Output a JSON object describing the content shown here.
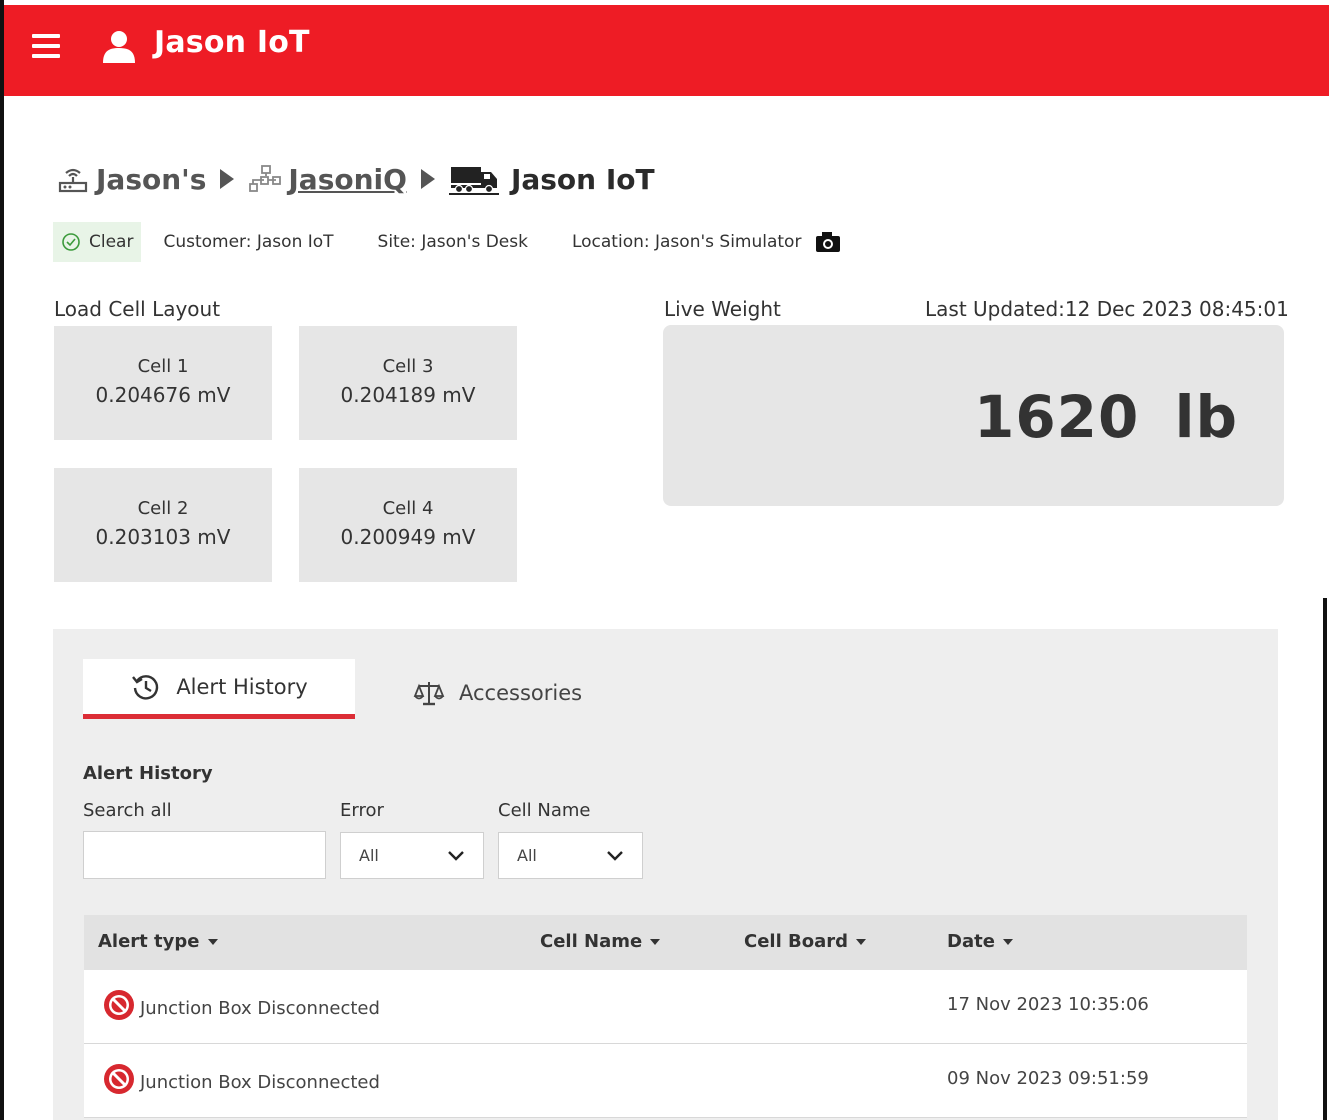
{
  "header": {
    "title": "Jason IoT"
  },
  "breadcrumb": {
    "items": [
      {
        "label": "Jason's",
        "icon": "router-icon"
      },
      {
        "label": "JasoniQ",
        "icon": "network-tree-icon"
      },
      {
        "label": "Jason IoT",
        "icon": "truck-icon"
      }
    ]
  },
  "info": {
    "status": "Clear",
    "customer": "Customer: Jason IoT",
    "site": "Site: Jason's Desk",
    "location": "Location: Jason's Simulator"
  },
  "load_cell": {
    "title": "Load Cell Layout",
    "cells": [
      {
        "name": "Cell 1",
        "value": "0.204676 mV"
      },
      {
        "name": "Cell 3",
        "value": "0.204189 mV"
      },
      {
        "name": "Cell 2",
        "value": "0.203103 mV"
      },
      {
        "name": "Cell 4",
        "value": "0.200949 mV"
      }
    ]
  },
  "live_weight": {
    "title": "Live Weight",
    "last_updated": "Last Updated:12 Dec 2023 08:45:01",
    "value": "1620 lb"
  },
  "tabs": [
    {
      "label": "Alert History",
      "icon": "history-icon",
      "active": true
    },
    {
      "label": "Accessories",
      "icon": "scale-icon",
      "active": false
    }
  ],
  "alert_history": {
    "heading": "Alert History",
    "search_label": "Search all",
    "search_value": "",
    "error_label": "Error",
    "error_selected": "All",
    "cell_name_label": "Cell Name",
    "cell_name_selected": "All",
    "columns": [
      "Alert type",
      "Cell Name",
      "Cell Board",
      "Date"
    ],
    "rows": [
      {
        "alert_type": "Junction Box Disconnected",
        "cell_name": "",
        "cell_board": "",
        "date": "17 Nov 2023 10:35:06"
      },
      {
        "alert_type": "Junction Box Disconnected",
        "cell_name": "",
        "cell_board": "",
        "date": "09 Nov 2023 09:51:59"
      }
    ]
  },
  "colors": {
    "brand": "#ee1c25",
    "tab_accent": "#dc2d36",
    "status_bg": "#e8f4e7",
    "alert_red": "#d7282f"
  }
}
